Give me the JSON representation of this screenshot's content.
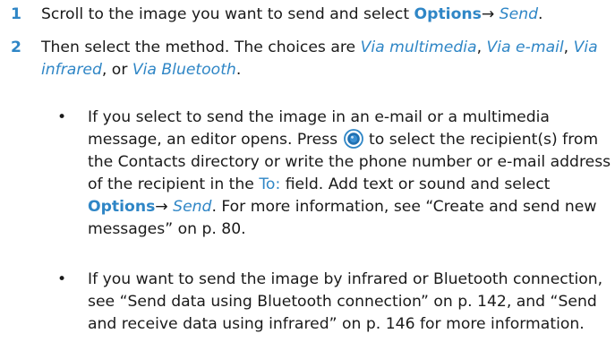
{
  "steps": [
    {
      "num": "1",
      "t1": "Scroll to the image you want to send and select ",
      "opt": "Options",
      "arrow": "→ ",
      "send": "Send",
      "t2": "."
    },
    {
      "num": "2",
      "t1": "Then select the method. The choices are ",
      "m1": "Via multimedia",
      "c1": ", ",
      "m2": "Via e-mail",
      "c2": ", ",
      "m3": "Via infrared",
      "c3": ", or ",
      "m4": "Via Bluetooth",
      "t2": "."
    }
  ],
  "bullets": [
    {
      "dot": "•",
      "t1": "If you select to send the image in an e-mail or a multimedia message, an editor opens. Press ",
      "icon": "navigation-key-icon",
      "t2": " to select the recipient(s) from the Contacts directory or write the phone number or e-mail address of the recipient in the ",
      "to_field": "To:",
      "t3": " field. Add text or sound and select ",
      "opt": "Options",
      "arrow": "→ ",
      "send": "Send",
      "t4": ". For more information, see “Create and send new messages” on p. 80."
    },
    {
      "dot": "•",
      "t1": "If you want to send the image by infrared or Bluetooth connection, see “Send data using Bluetooth connection” on p. 142, and “Send and receive data using infrared” on p. 146 for more information."
    }
  ],
  "colors": {
    "accent": "#2f86c6",
    "text": "#1a1a1a"
  }
}
